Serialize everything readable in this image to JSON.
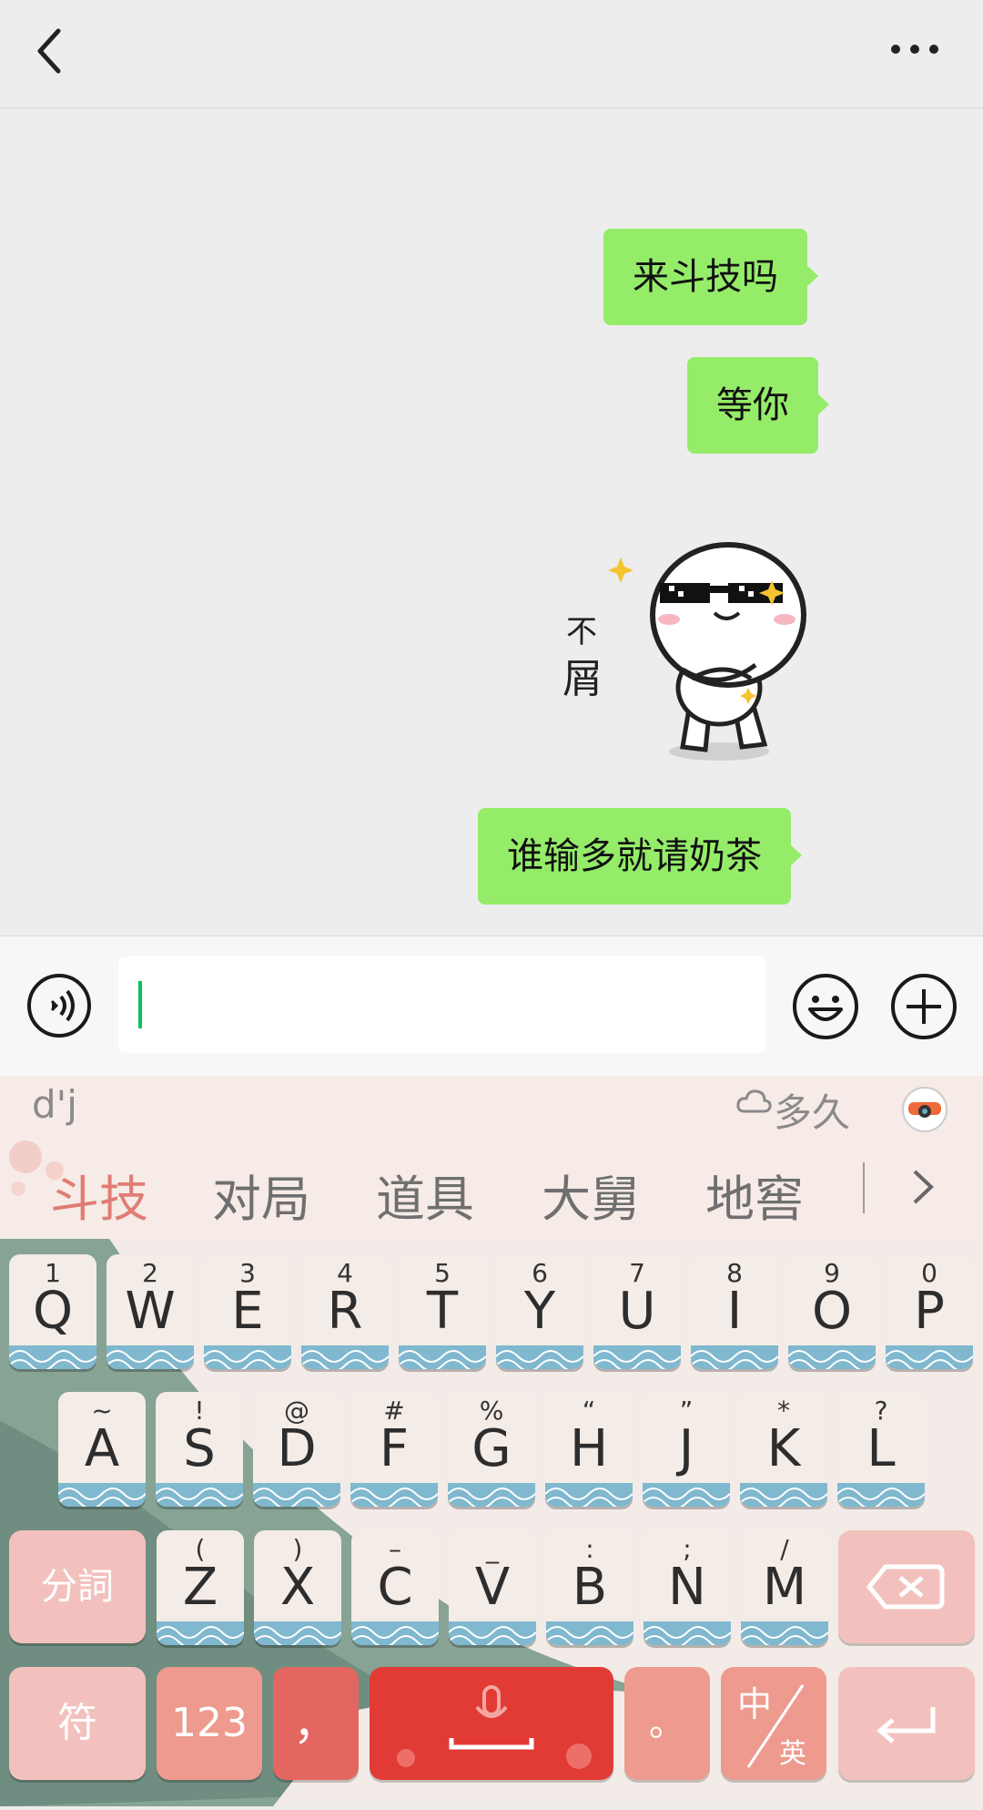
{
  "header": {
    "back_icon": "chevron-left-icon",
    "more_icon": "more-dots-icon"
  },
  "chat": {
    "messages": [
      {
        "type": "text",
        "text": "来斗技吗"
      },
      {
        "type": "text",
        "text": "等你"
      },
      {
        "type": "sticker",
        "caption": "不屑"
      },
      {
        "type": "text",
        "text": "谁输多就请奶茶"
      }
    ]
  },
  "input_bar": {
    "voice_icon": "voice-icon",
    "text_value": "",
    "emoji_icon": "emoji-icon",
    "plus_icon": "plus-icon"
  },
  "keyboard": {
    "composing": "d'j",
    "cloud_suggestion": "多久",
    "candidates": [
      "斗技",
      "对局",
      "道具",
      "大舅",
      "地窖"
    ],
    "rows": [
      [
        {
          "sub": "1",
          "main": "Q"
        },
        {
          "sub": "2",
          "main": "W"
        },
        {
          "sub": "3",
          "main": "E"
        },
        {
          "sub": "4",
          "main": "R"
        },
        {
          "sub": "5",
          "main": "T"
        },
        {
          "sub": "6",
          "main": "Y"
        },
        {
          "sub": "7",
          "main": "U"
        },
        {
          "sub": "8",
          "main": "I"
        },
        {
          "sub": "9",
          "main": "O"
        },
        {
          "sub": "0",
          "main": "P"
        }
      ],
      [
        {
          "sub": "~",
          "main": "A"
        },
        {
          "sub": "!",
          "main": "S"
        },
        {
          "sub": "@",
          "main": "D"
        },
        {
          "sub": "#",
          "main": "F"
        },
        {
          "sub": "%",
          "main": "G"
        },
        {
          "sub": "“",
          "main": "H"
        },
        {
          "sub": "”",
          "main": "J"
        },
        {
          "sub": "*",
          "main": "K"
        },
        {
          "sub": "?",
          "main": "L"
        }
      ],
      [
        {
          "sub": "(",
          "main": "Z"
        },
        {
          "sub": ")",
          "main": "X"
        },
        {
          "sub": "–",
          "main": "C"
        },
        {
          "sub": "_",
          "main": "V"
        },
        {
          "sub": ":",
          "main": "B"
        },
        {
          "sub": ";",
          "main": "N"
        },
        {
          "sub": "/",
          "main": "M"
        }
      ]
    ],
    "fn": {
      "split": "分詞",
      "symbol": "符",
      "numbers": "123",
      "comma": "，",
      "period": "。",
      "lang_top": "中",
      "lang_bottom": "英"
    },
    "colors": {
      "accent_red": "#e84a47",
      "key_pink": "#f3c1bd",
      "wave_blue": "#7fb8cf"
    }
  }
}
